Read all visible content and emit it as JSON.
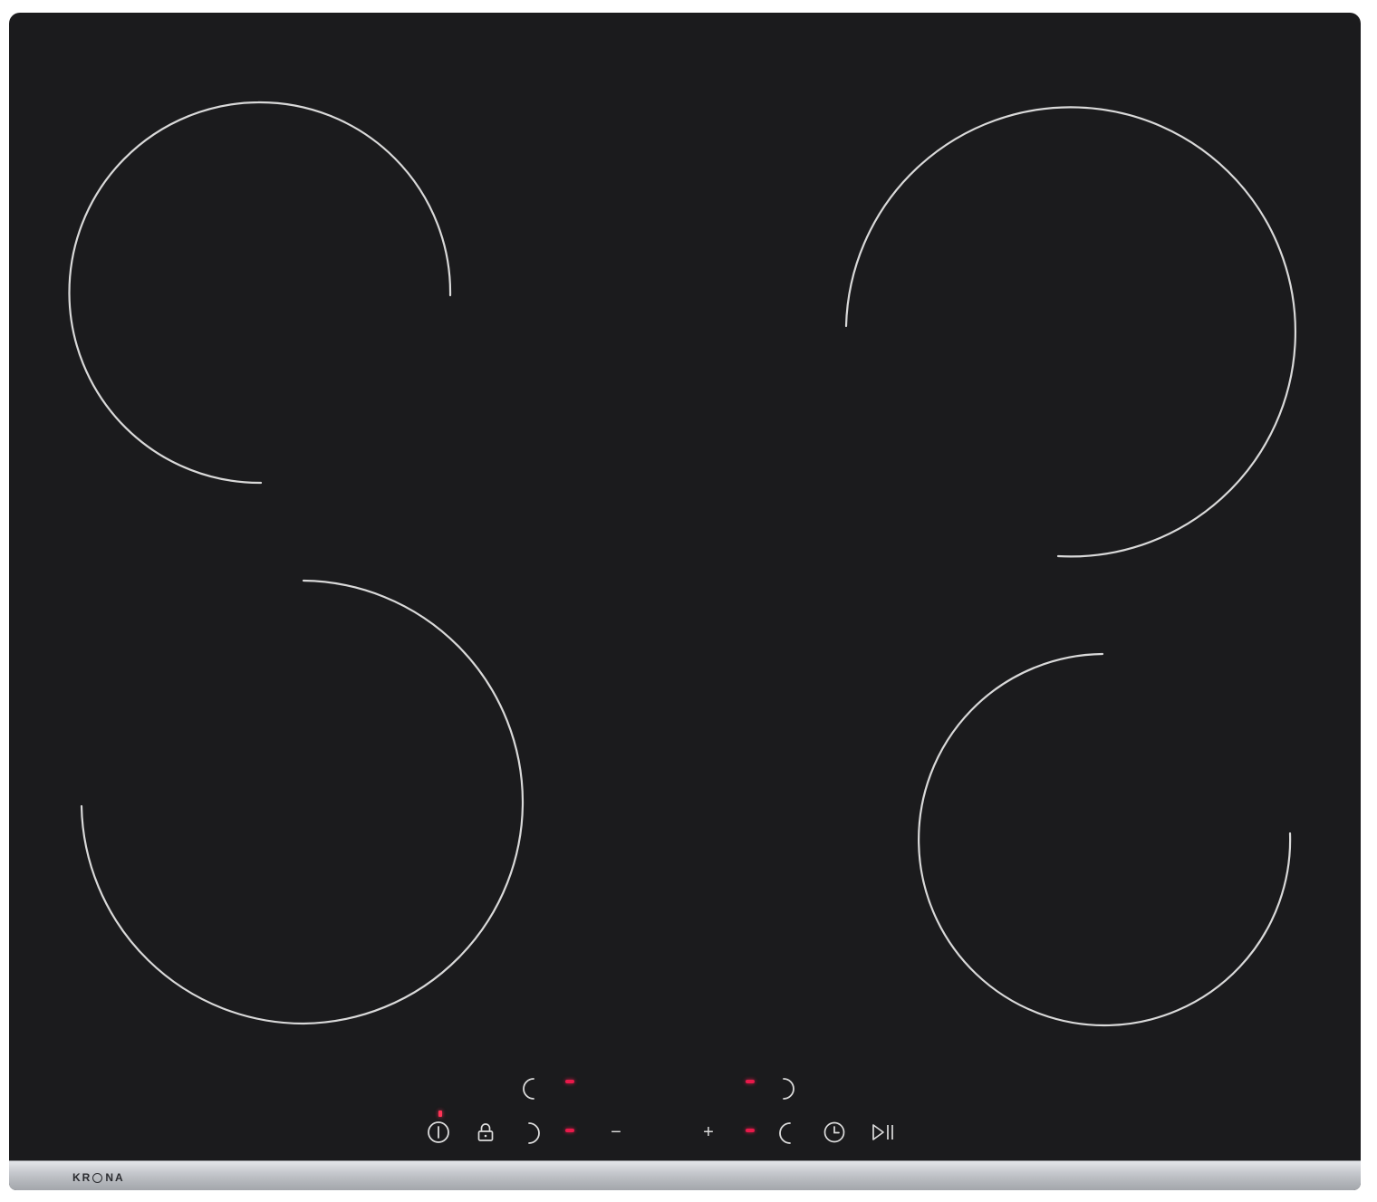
{
  "brand": {
    "part1": "KR",
    "part2": "NA"
  },
  "zones": [
    {
      "name": "rear-left"
    },
    {
      "name": "rear-right"
    },
    {
      "name": "front-left"
    },
    {
      "name": "front-right"
    }
  ],
  "controls": {
    "power_icon": "power-icon",
    "lock_icon": "lock-icon",
    "minus_label": "−",
    "plus_label": "+",
    "timer_icon": "clock-icon",
    "play_pause_icon": "play-pause-icon"
  },
  "colors": {
    "glass": "#1b1b1d",
    "zone_ring": "#d9d9d9",
    "indicator": "#e8194a",
    "trim": "#c0c2c6"
  }
}
